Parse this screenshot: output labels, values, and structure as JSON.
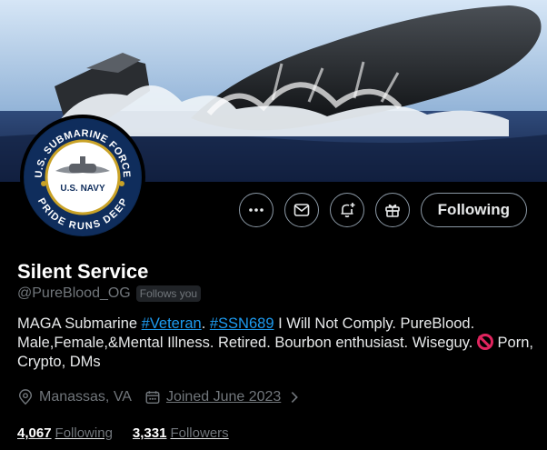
{
  "profile": {
    "display_name": "Silent Service",
    "handle": "@PureBlood_OG",
    "follows_you": "Follows you",
    "bio_parts": {
      "prefix": "MAGA Submarine ",
      "hashtag1": "#Veteran",
      "sep": ". ",
      "hashtag2": "#SSN689",
      "suffix": " I Will Not Comply. PureBlood. Male,Female,&Mental Illness. Retired. Bourbon enthusiast. Wiseguy. ",
      "tail": " Porn, Crypto, DMs"
    },
    "location": "Manassas, VA",
    "joined": "Joined June 2023",
    "following_count": "4,067",
    "following_label": "Following",
    "followers_count": "3,331",
    "followers_label": "Followers"
  },
  "actions": {
    "more_icon": "more-icon",
    "message_icon": "mail-icon",
    "notify_icon": "bell-plus-icon",
    "gift_icon": "gift-icon",
    "follow_label": "Following"
  },
  "avatar": {
    "ring_top": "U.S. SUBMARINE FORCE",
    "ring_bottom": "PRIDE RUNS DEEP",
    "center": "U.S. NAVY"
  },
  "colors": {
    "background": "#000000",
    "text": "#e7e9ea",
    "muted": "#71767b",
    "link": "#1d9bf0",
    "border": "#8b98a5"
  }
}
